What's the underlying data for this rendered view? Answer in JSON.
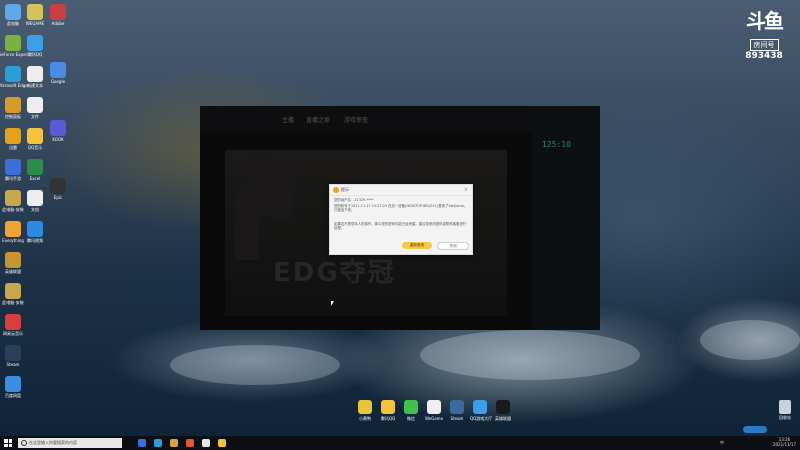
{
  "watermark": {
    "logo": "斗鱼",
    "room_label": "房间号",
    "room_number": "893438"
  },
  "desktop_icons": [
    {
      "label": "此电脑",
      "color": "#5da9e9"
    },
    {
      "label": "GeForce Experience",
      "color": "#78b33e"
    },
    {
      "label": "Microsoft Edge",
      "color": "#2a9fd6"
    },
    {
      "label": "控制面板",
      "color": "#d69b2a"
    },
    {
      "label": "迅雷",
      "color": "#e4a21c"
    },
    {
      "label": "腾讯手游",
      "color": "#3a6ed8"
    },
    {
      "label": "此电脑-安装",
      "color": "#c9a64a"
    },
    {
      "label": "Everything",
      "color": "#f0a232"
    },
    {
      "label": "英雄联盟",
      "color": "#c89430"
    },
    {
      "label": "此电脑-安装",
      "color": "#c9a64a"
    },
    {
      "label": "网易云音乐",
      "color": "#d93e3e"
    },
    {
      "label": "Steam",
      "color": "#2a3f5a"
    },
    {
      "label": "百度网盘",
      "color": "#3a8fe0"
    }
  ],
  "desktop_icons_col2": [
    {
      "label": "WEGAME",
      "color": "#d6c15a"
    },
    {
      "label": "腾讯QQ",
      "color": "#3aa0e8"
    },
    {
      "label": "新建文本",
      "color": "#eeeeee"
    },
    {
      "label": "文件",
      "color": "#eeeeee"
    },
    {
      "label": "QQ音乐",
      "color": "#f3c33a"
    },
    {
      "label": "Excel",
      "color": "#2f8b4c"
    },
    {
      "label": "文档",
      "color": "#eeeeee"
    },
    {
      "label": "腾讯视频",
      "color": "#2a8be0"
    }
  ],
  "desktop_icons_col3": [
    {
      "label": "Adobe",
      "color": "#c84040"
    },
    {
      "label": "Google",
      "color": "#4a8ae8"
    },
    {
      "label": "KOOK",
      "color": "#5a5ad8"
    },
    {
      "label": "Epic",
      "color": "#333333"
    }
  ],
  "app": {
    "nav": [
      "主播",
      "直播之家",
      "游戏审查"
    ],
    "timer": "125:10",
    "poster_title": "EDG夺冠",
    "dialog": {
      "title": "提示",
      "close": "×",
      "msg1": "您的用户名：Z1329-****",
      "msg2": "您的帐号于2021-11-17 15:27:29 在另一设备(DESKTOP-8BLJ511)登录了WeGame，已被迫下线。",
      "msg3": "如果这不是您本人的操作，那么您的密码可能已经泄露。建议您修改密码或联系客服进行处理。",
      "primary": "重新登录",
      "cancel": "关闭"
    }
  },
  "dock": [
    {
      "label": "小黄鸭",
      "color": "#e9c437"
    },
    {
      "label": "腾讯QQ",
      "color": "#f3c33a"
    },
    {
      "label": "微信",
      "color": "#3ec24c"
    },
    {
      "label": "WeGame",
      "color": "#efefef"
    },
    {
      "label": "Steam",
      "color": "#3a6aa0"
    },
    {
      "label": "QQ游戏大厅",
      "color": "#3a9ee8"
    },
    {
      "label": "英雄联盟",
      "color": "#1a1a1a"
    }
  ],
  "recycle": "回收站",
  "taskbar": {
    "search_placeholder": "在这里输入你要搜索的内容",
    "time": "13:26",
    "date": "2021/11/17",
    "lang": "中",
    "apps": [
      "#3a6ed8",
      "#2a9fd6",
      "#d8a23a",
      "#e05a2a",
      "#e8e8e8",
      "#f3c33a"
    ]
  }
}
